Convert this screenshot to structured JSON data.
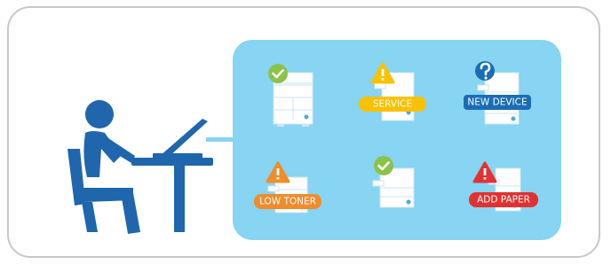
{
  "colors": {
    "panel": "#87d4f3",
    "person": "#1f66ad",
    "printer_body": "#ffffff",
    "printer_line": "#cfe6f3",
    "printer_accent": "#43aedb",
    "ok": "#8bc34a",
    "service": "#f9c100",
    "question": "#1a6db5",
    "low_toner": "#f08c2b",
    "add_paper": "#e13232",
    "frame_border": "#c8c8c8"
  },
  "printers": [
    {
      "id": "p1",
      "status_icon": "check-icon",
      "label": ""
    },
    {
      "id": "p2",
      "status_icon": "warning-icon",
      "label": "SERVICE"
    },
    {
      "id": "p3",
      "status_icon": "question-icon",
      "label": "NEW DEVICE"
    },
    {
      "id": "p4",
      "status_icon": "warning-icon",
      "label": "LOW TONER"
    },
    {
      "id": "p5",
      "status_icon": "check-icon",
      "label": ""
    },
    {
      "id": "p6",
      "status_icon": "warning-icon",
      "label": "ADD PAPER"
    }
  ]
}
